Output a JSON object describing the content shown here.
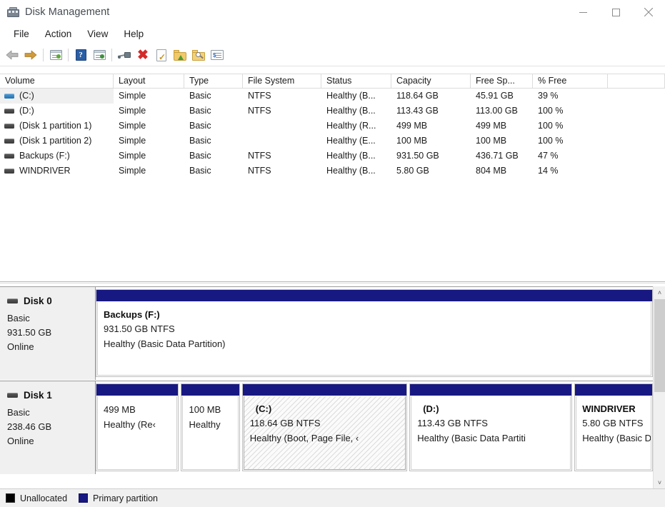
{
  "window": {
    "title": "Disk Management",
    "icon": "disk-management-icon",
    "controls": {
      "minimize": "minimize-icon",
      "maximize": "maximize-icon",
      "close": "close-icon"
    }
  },
  "menu": {
    "items": [
      "File",
      "Action",
      "View",
      "Help"
    ]
  },
  "toolbar": {
    "buttons": [
      {
        "name": "back-icon",
        "label": "Back"
      },
      {
        "name": "forward-icon",
        "label": "Forward"
      },
      {
        "name": "show-hide-console-tree-icon",
        "label": "Show/Hide Console Tree"
      },
      {
        "name": "help-icon",
        "label": "Help"
      },
      {
        "name": "show-hide-action-pane-icon",
        "label": "Show/Hide Action Pane"
      },
      {
        "name": "connect-icon",
        "label": "Connect"
      },
      {
        "name": "delete-icon",
        "label": "Delete"
      },
      {
        "name": "properties-icon",
        "label": "Properties"
      },
      {
        "name": "folder-up-icon",
        "label": "Up"
      },
      {
        "name": "folder-search-icon",
        "label": "Find"
      },
      {
        "name": "console-properties-icon",
        "label": "Console"
      }
    ]
  },
  "volume_list": {
    "columns": [
      "Volume",
      "Layout",
      "Type",
      "File System",
      "Status",
      "Capacity",
      "Free Sp...",
      "% Free",
      ""
    ],
    "rows": [
      {
        "volume": "(C:)",
        "icon_color": "#2f7fc1",
        "selected": true,
        "layout": "Simple",
        "type": "Basic",
        "file_system": "NTFS",
        "status": "Healthy (B...",
        "capacity": "118.64 GB",
        "free_space": "45.91 GB",
        "pct_free": "39 %"
      },
      {
        "volume": "(D:)",
        "icon_color": "#3a3a3a",
        "selected": false,
        "layout": "Simple",
        "type": "Basic",
        "file_system": "NTFS",
        "status": "Healthy (B...",
        "capacity": "113.43 GB",
        "free_space": "113.00 GB",
        "pct_free": "100 %"
      },
      {
        "volume": "(Disk 1 partition 1)",
        "icon_color": "#3a3a3a",
        "selected": false,
        "layout": "Simple",
        "type": "Basic",
        "file_system": "",
        "status": "Healthy (R...",
        "capacity": "499 MB",
        "free_space": "499 MB",
        "pct_free": "100 %"
      },
      {
        "volume": "(Disk 1 partition 2)",
        "icon_color": "#3a3a3a",
        "selected": false,
        "layout": "Simple",
        "type": "Basic",
        "file_system": "",
        "status": "Healthy (E...",
        "capacity": "100 MB",
        "free_space": "100 MB",
        "pct_free": "100 %"
      },
      {
        "volume": "Backups (F:)",
        "icon_color": "#3a3a3a",
        "selected": false,
        "layout": "Simple",
        "type": "Basic",
        "file_system": "NTFS",
        "status": "Healthy (B...",
        "capacity": "931.50 GB",
        "free_space": "436.71 GB",
        "pct_free": "47 %"
      },
      {
        "volume": "WINDRIVER",
        "icon_color": "#3a3a3a",
        "selected": false,
        "layout": "Simple",
        "type": "Basic",
        "file_system": "NTFS",
        "status": "Healthy (B...",
        "capacity": "5.80 GB",
        "free_space": "804 MB",
        "pct_free": "14 %"
      }
    ]
  },
  "disks": [
    {
      "name": "Disk 0",
      "kind": "Basic",
      "size": "931.50 GB",
      "state": "Online",
      "partitions": [
        {
          "name": "Backups  (F:)",
          "size_fs": "931.50 GB NTFS",
          "status": "Healthy (Basic Data Partition)",
          "selected": false,
          "indent": false
        }
      ]
    },
    {
      "name": "Disk 1",
      "kind": "Basic",
      "size": "238.46 GB",
      "state": "Online",
      "partitions": [
        {
          "name": "",
          "size_fs": "499 MB",
          "status": "Healthy (Re‹",
          "selected": false,
          "indent": false
        },
        {
          "name": "",
          "size_fs": "100 MB",
          "status": "Healthy",
          "selected": false,
          "indent": false
        },
        {
          "name": "(C:)",
          "size_fs": "118.64 GB NTFS",
          "status": "Healthy (Boot, Page File, ‹",
          "selected": true,
          "indent": true
        },
        {
          "name": "(D:)",
          "size_fs": "113.43 GB NTFS",
          "status": "Healthy (Basic Data Partiti",
          "selected": false,
          "indent": true
        },
        {
          "name": "WINDRIVER",
          "size_fs": "5.80 GB NTFS",
          "status": "Healthy (Basic Data‹",
          "selected": false,
          "indent": false
        }
      ]
    }
  ],
  "legend": {
    "items": [
      {
        "label": "Unallocated",
        "color": "#000000"
      },
      {
        "label": "Primary partition",
        "color": "#181882"
      }
    ]
  },
  "scrollbar": {
    "up": "˄",
    "down": "˅"
  }
}
